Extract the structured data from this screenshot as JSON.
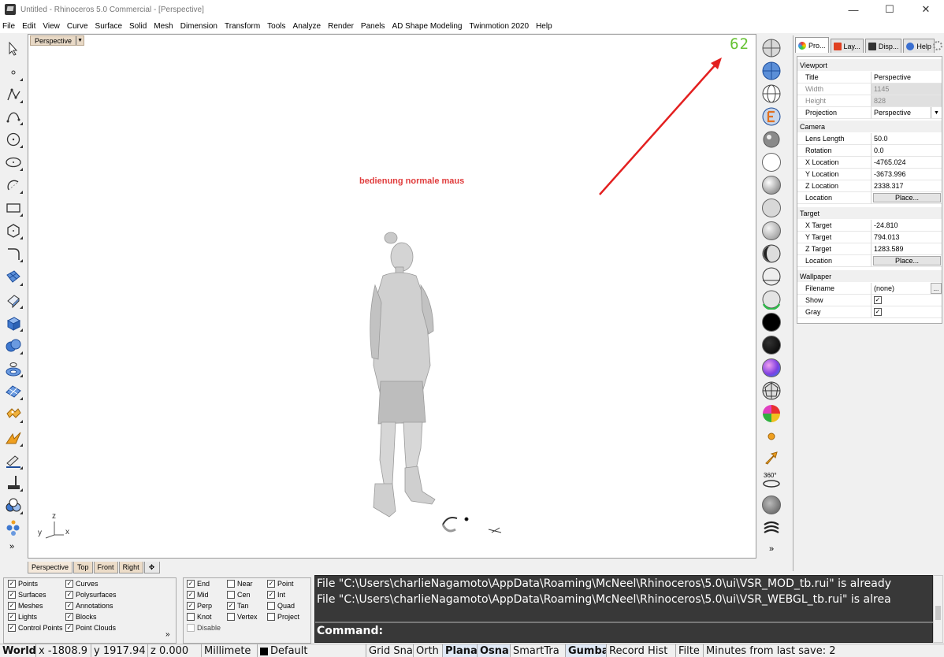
{
  "window": {
    "title": "Untitled - Rhinoceros 5.0 Commercial - [Perspective]",
    "controls": {
      "minimize": "—",
      "maximize": "☐",
      "close": "✕"
    }
  },
  "menu": [
    "File",
    "Edit",
    "View",
    "Curve",
    "Surface",
    "Solid",
    "Mesh",
    "Dimension",
    "Transform",
    "Tools",
    "Analyze",
    "Render",
    "Panels",
    "AD Shape Modeling",
    "Twinmotion 2020",
    "Help"
  ],
  "left_toolbar": {
    "tools": [
      "select-arrow-icon",
      "point-icon",
      "polyline-icon",
      "curve-icon",
      "circle-icon",
      "ellipse-icon",
      "arc-icon",
      "rectangle-icon",
      "polygon-icon",
      "fillet-curve-icon",
      "surface-icon",
      "extrude-icon",
      "box-icon",
      "solid-tools-icon",
      "mesh-icon",
      "nurbs-surface-icon",
      "puzzle-icon",
      "transform-icon",
      "dimension-icon",
      "section-icon",
      "render-icon",
      "more-icon"
    ],
    "more": "»"
  },
  "viewport": {
    "label": "Perspective",
    "dropdown": "▼",
    "fps": "62",
    "note": "bedienung normale maus",
    "axis": {
      "z": "z",
      "y": "y",
      "x": "x"
    },
    "accent_arrow_color": "#e32020"
  },
  "viewport_tabs": [
    "Perspective",
    "Top",
    "Front",
    "Right",
    "✥"
  ],
  "right_toolbar": {
    "buttons": [
      "wireframe-viewport-icon",
      "shaded-viewport-icon",
      "rendered-viewport-icon",
      "ghosted-viewport-icon",
      "xray-viewport-icon",
      "white-sphere-icon",
      "textured-sphere-icon",
      "gray-sphere-icon",
      "artistic-sphere-icon",
      "technical-sphere-icon",
      "pen-sphere-icon",
      "half-shaded-sphere-icon",
      "black-sphere-icon",
      "dark-sphere-icon",
      "rainbow-sphere-icon",
      "mesh-sphere-icon",
      "color-wheel-icon",
      "light-bulb-icon",
      "sun-arrow-icon",
      "rotate-360-icon",
      "render-preview-icon",
      "spiral-icon"
    ],
    "label_360": "360°",
    "more": "»"
  },
  "properties": {
    "tabs": [
      "Pro...",
      "Lay...",
      "Disp...",
      "Help"
    ],
    "viewport_section": "Viewport",
    "title_label": "Title",
    "title_value": "Perspective",
    "width_label": "Width",
    "width_value": "1145",
    "height_label": "Height",
    "height_value": "828",
    "projection_label": "Projection",
    "projection_value": "Perspective",
    "camera_section": "Camera",
    "lens_label": "Lens Length",
    "lens_value": "50.0",
    "rotation_label": "Rotation",
    "rotation_value": "0.0",
    "xloc_label": "X Location",
    "xloc_value": "-4765.024",
    "yloc_label": "Y Location",
    "yloc_value": "-3673.996",
    "zloc_label": "Z Location",
    "zloc_value": "2338.317",
    "location_label": "Location",
    "place_button": "Place...",
    "target_section": "Target",
    "xt_label": "X Target",
    "xt_value": "-24.810",
    "yt_label": "Y Target",
    "yt_value": "794.013",
    "zt_label": "Z Target",
    "zt_value": "1283.589",
    "tlocation_label": "Location",
    "tplace_button": "Place...",
    "wallpaper_section": "Wallpaper",
    "filename_label": "Filename",
    "filename_value": "(none)",
    "filename_btn": "...",
    "show_label": "Show",
    "gray_label": "Gray",
    "checkmark": "✓"
  },
  "filters": {
    "items": [
      {
        "label": "Points",
        "checked": true
      },
      {
        "label": "Curves",
        "checked": true
      },
      {
        "label": "Surfaces",
        "checked": true
      },
      {
        "label": "Polysurfaces",
        "checked": true
      },
      {
        "label": "Meshes",
        "checked": true
      },
      {
        "label": "Annotations",
        "checked": true
      },
      {
        "label": "Lights",
        "checked": true
      },
      {
        "label": "Blocks",
        "checked": true
      },
      {
        "label": "Control Points",
        "checked": true
      },
      {
        "label": "Point Clouds",
        "checked": true
      }
    ],
    "more": "»"
  },
  "osnaps": {
    "items": [
      {
        "label": "End",
        "checked": true
      },
      {
        "label": "Near",
        "checked": false
      },
      {
        "label": "Point",
        "checked": true
      },
      {
        "label": "Mid",
        "checked": true
      },
      {
        "label": "Cen",
        "checked": false
      },
      {
        "label": "Int",
        "checked": true
      },
      {
        "label": "Perp",
        "checked": true
      },
      {
        "label": "Tan",
        "checked": true
      },
      {
        "label": "Quad",
        "checked": false
      },
      {
        "label": "Knot",
        "checked": false
      },
      {
        "label": "Vertex",
        "checked": false
      },
      {
        "label": "Project",
        "checked": false
      },
      {
        "label": "Disable",
        "checked": false
      }
    ]
  },
  "command": {
    "history": [
      "File \"C:\\Users\\charlieNagamoto\\AppData\\Roaming\\McNeel\\Rhinoceros\\5.0\\ui\\VSR_MOD_tb.rui\" is already",
      "File \"C:\\Users\\charlieNagamoto\\AppData\\Roaming\\McNeel\\Rhinoceros\\5.0\\ui\\VSR_WEBGL_tb.rui\" is alrea"
    ],
    "prompt": "Command:"
  },
  "statusbar": {
    "world": "World",
    "x": "x -1808.9",
    "y": "y 1917.94",
    "z": "z 0.000",
    "units": "Millimete",
    "layer": "Default",
    "grid_snap": "Grid Sna",
    "ortho": "Orth",
    "planar": "Plana",
    "osnap": "Osna",
    "smarttrack": "SmartTra",
    "gumball": "Gumba",
    "record_history": "Record Hist",
    "filter": "Filte",
    "save_info": "Minutes from last save: 2"
  }
}
